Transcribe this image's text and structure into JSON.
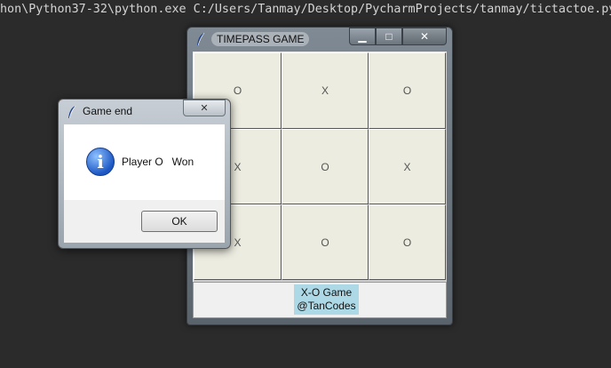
{
  "terminal": {
    "command_line": "hon\\Python37-32\\python.exe C:/Users/Tanmay/Desktop/PycharmProjects/tanmay/tictactoe.py"
  },
  "main_window": {
    "title": "TIMEPASS GAME",
    "buttons": {
      "minimize": "▁",
      "maximize": "□",
      "close": "✕"
    },
    "board": [
      [
        "O",
        "X",
        "O"
      ],
      [
        "X",
        "O",
        "X"
      ],
      [
        "X",
        "O",
        "O"
      ]
    ],
    "footer_label": {
      "line1": "X-O Game",
      "line2": "@TanCodes"
    }
  },
  "dialog": {
    "title": "Game end",
    "close": "✕",
    "message": "Player O   Won",
    "ok_label": "OK",
    "icon": "info-icon"
  },
  "colors": {
    "background": "#2b2b2b",
    "cell": "#ecece0",
    "footer_label_bg": "#add8e6"
  }
}
